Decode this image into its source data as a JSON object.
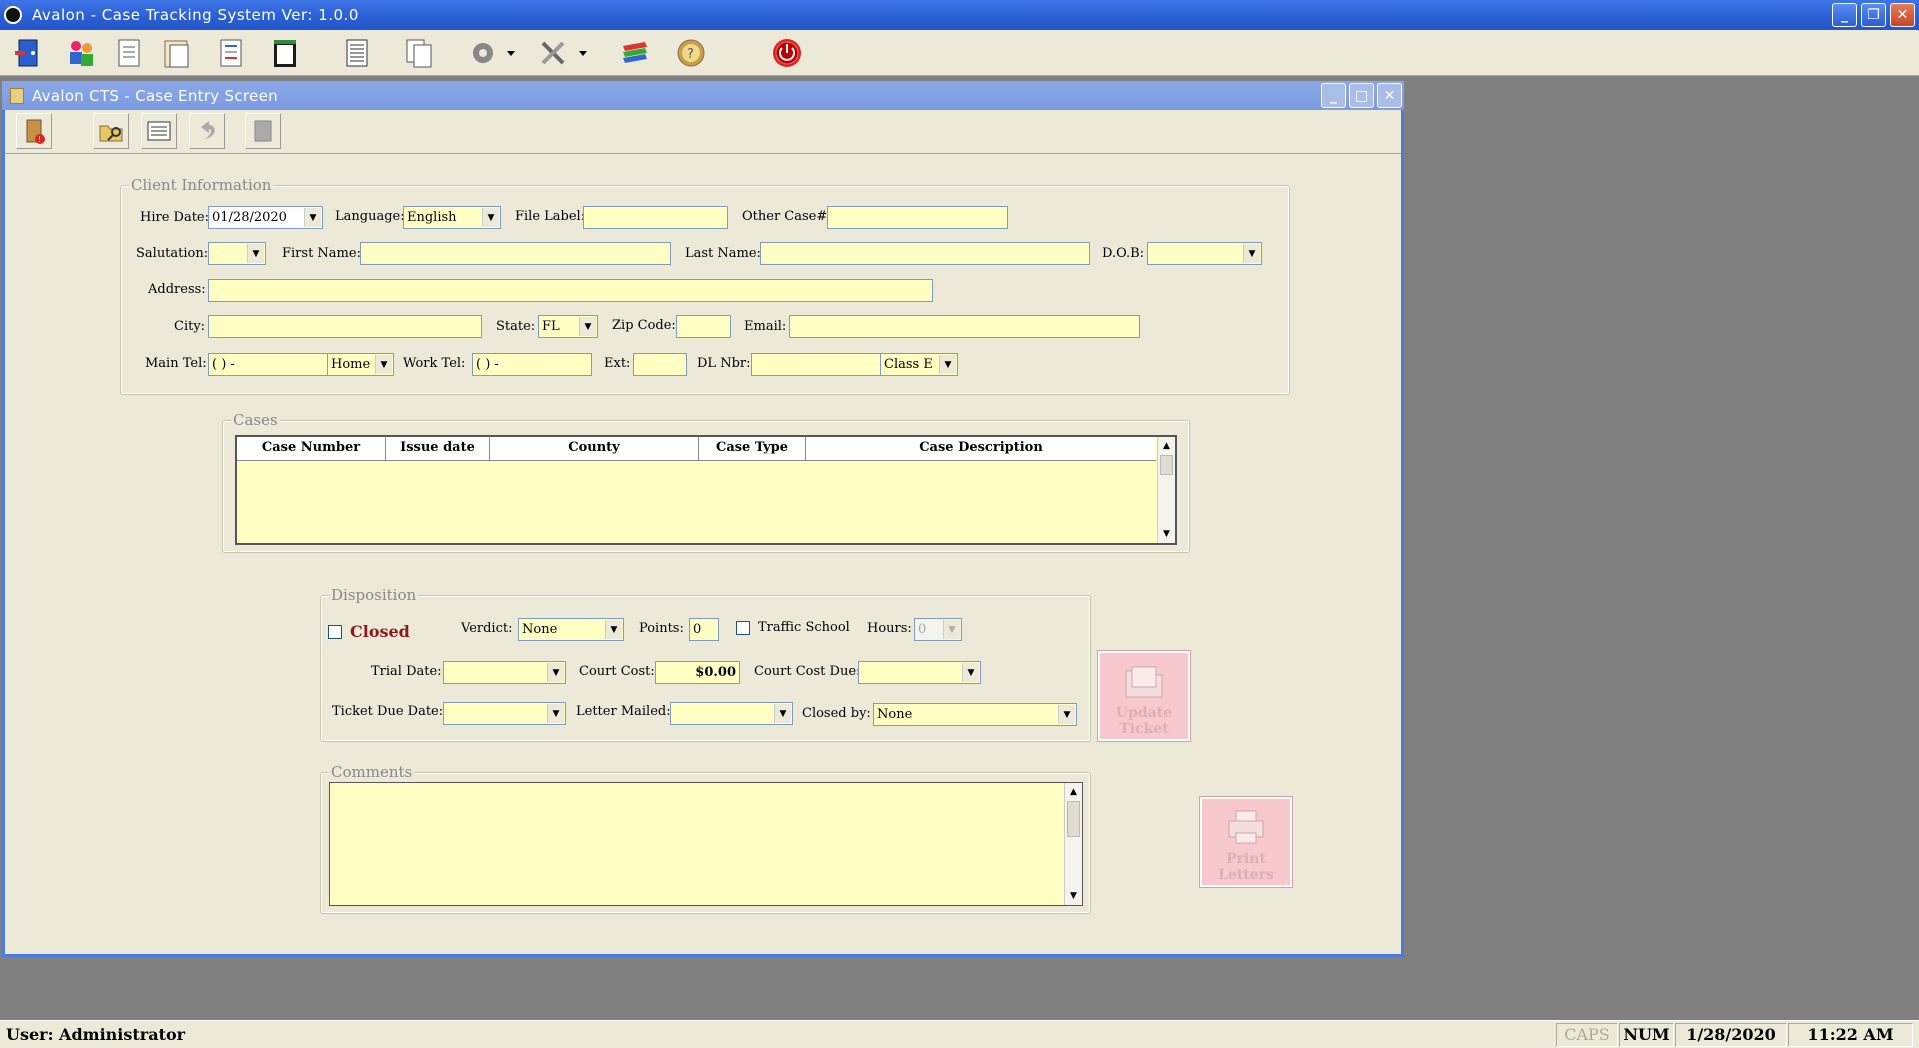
{
  "app": {
    "title": "Avalon - Case Tracking System   Ver: 1.0.0",
    "window_controls": {
      "minimize": "_",
      "restore": "❐",
      "close": "✕"
    }
  },
  "main_toolbar": {
    "buttons": [
      {
        "icon": "exit-door-icon"
      },
      {
        "icon": "users-icon"
      },
      {
        "icon": "document-icon"
      },
      {
        "icon": "clipboard-icon"
      },
      {
        "icon": "checklist-icon"
      },
      {
        "icon": "notepad-icon"
      },
      {
        "icon": "report-icon"
      },
      {
        "icon": "copy-documents-icon"
      },
      {
        "icon": "settings-gear-icon"
      },
      {
        "icon": "tools-icon"
      },
      {
        "icon": "stacked-layers-icon"
      },
      {
        "icon": "help-icon"
      },
      {
        "icon": "power-icon"
      }
    ]
  },
  "child_window": {
    "title": "Avalon CTS - Case Entry Screen",
    "toolbar": [
      {
        "icon": "exit-record-icon"
      },
      {
        "icon": "open-folder-icon"
      },
      {
        "icon": "list-form-icon"
      },
      {
        "icon": "undo-icon"
      },
      {
        "icon": "blank-page-icon"
      }
    ]
  },
  "client_info": {
    "group_label": "Client Information",
    "hire_date_label": "Hire Date:",
    "hire_date_value": "01/28/2020",
    "language_label": "Language:",
    "language_value": "English",
    "file_label_label": "File Label:",
    "file_label_value": "",
    "other_case_label": "Other Case#:",
    "other_case_value": "",
    "salutation_label": "Salutation:",
    "salutation_value": "",
    "first_name_label": "First Name:",
    "first_name_value": "",
    "last_name_label": "Last Name:",
    "last_name_value": "",
    "dob_label": "D.O.B:",
    "dob_value": "",
    "address_label": "Address:",
    "address_value": "",
    "city_label": "City:",
    "city_value": "",
    "state_label": "State:",
    "state_value": "FL",
    "zip_label": "Zip Code:",
    "zip_value": "",
    "email_label": "Email:",
    "email_value": "",
    "main_tel_label": "Main Tel:",
    "main_tel_value": "( )   -",
    "main_tel_type": "Home",
    "work_tel_label": "Work Tel:",
    "work_tel_value": "( )   -",
    "ext_label": "Ext:",
    "ext_value": "",
    "dl_label": "DL Nbr:",
    "dl_value": "",
    "dl_class": "Class E"
  },
  "cases": {
    "group_label": "Cases",
    "columns": [
      "Case Number",
      "Issue date",
      "County",
      "Case Type",
      "Case Description"
    ],
    "rows": []
  },
  "disposition": {
    "group_label": "Disposition",
    "closed_label": "Closed",
    "closed_checked": false,
    "verdict_label": "Verdict:",
    "verdict_value": "None",
    "points_label": "Points:",
    "points_value": "0",
    "traffic_school_label": "Traffic School",
    "traffic_school_checked": false,
    "hours_label": "Hours:",
    "hours_value": "0",
    "trial_date_label": "Trial Date:",
    "trial_date_value": "",
    "court_cost_label": "Court Cost:",
    "court_cost_value": "$0.00",
    "court_cost_due_label": "Court Cost Due:",
    "court_cost_due_value": "",
    "ticket_due_label": "Ticket Due Date:",
    "ticket_due_value": "",
    "letter_mailed_label": "Letter Mailed:",
    "letter_mailed_value": "",
    "closed_by_label": "Closed by:",
    "closed_by_value": "None"
  },
  "comments": {
    "group_label": "Comments",
    "value": ""
  },
  "buttons": {
    "update_ticket_line1": "Update",
    "update_ticket_line2": "Ticket",
    "print_letters_line1": "Print",
    "print_letters_line2": "Letters"
  },
  "colors": {
    "field_bg": "#ffffc4",
    "closed_text": "#8b1a1a",
    "pink_button": "#f7c8cc",
    "title_blue": "#2a5fd4"
  },
  "status_bar": {
    "user": "User: Administrator",
    "caps": "CAPS",
    "num": "NUM",
    "date": "1/28/2020",
    "time": "11:22 AM"
  }
}
